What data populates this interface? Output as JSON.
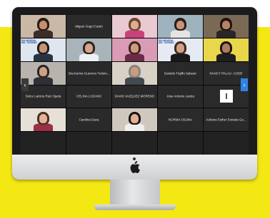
{
  "meeting": {
    "tiles": [
      {
        "name": "",
        "scene": "woman-dark-hair"
      },
      {
        "name": "Miguel Ángel Cantú",
        "scene": "name-only"
      },
      {
        "name": "",
        "scene": "woman-pink"
      },
      {
        "name": "",
        "scene": "woman-window"
      },
      {
        "name": "",
        "scene": "woman-curtain"
      },
      {
        "name": "",
        "scene": "man-banner"
      },
      {
        "name": "",
        "scene": "man-glasses"
      },
      {
        "name": "",
        "scene": "woman-pink-wall"
      },
      {
        "name": "",
        "scene": "woman-banner"
      },
      {
        "name": "",
        "scene": "man-yellow"
      },
      {
        "name": "",
        "scene": "man-office"
      },
      {
        "name": "Dra.Karina Guerrero Turism...",
        "scene": "name-only"
      },
      {
        "name": "",
        "scene": "man-grey"
      },
      {
        "name": "Daniela Trujillo Salazar",
        "scene": "name-only"
      },
      {
        "name": "NANCY PALAU -CODE",
        "scene": "name-only"
      },
      {
        "name": "Dulce Larizza Ruiz Ojeda",
        "scene": "name-only"
      },
      {
        "name": "CELINA LOZANO",
        "scene": "name-only"
      },
      {
        "name": "DAVID VAZQUEZ MORENO",
        "scene": "name-only"
      },
      {
        "name": "Jose Antonio Lastra",
        "scene": "name-only"
      },
      {
        "name": "",
        "scene": "logo-white"
      },
      {
        "name": "",
        "scene": "woman-light"
      },
      {
        "name": "Carolina Daza",
        "scene": "name-only"
      },
      {
        "name": "",
        "scene": "woman-long-hair"
      },
      {
        "name": "NORMA OSUNA",
        "scene": "name-only"
      },
      {
        "name": "Adriana Esther Estrada Go...",
        "scene": "name-only"
      },
      {
        "name": "",
        "scene": "empty"
      },
      {
        "name": "",
        "scene": "empty"
      },
      {
        "name": "",
        "scene": "empty"
      },
      {
        "name": "",
        "scene": "empty"
      },
      {
        "name": "",
        "scene": "empty"
      }
    ],
    "banner_text": "DÍA MUNDIAL\nDEL TURISMO",
    "nav_prev_icon": "chevron-left-icon",
    "nav_next_icon": "chevron-right-icon"
  },
  "device": {
    "logo_icon": "apple-logo-icon"
  },
  "colors": {
    "background": "#f4e814",
    "next_button": "#2e83e6"
  }
}
